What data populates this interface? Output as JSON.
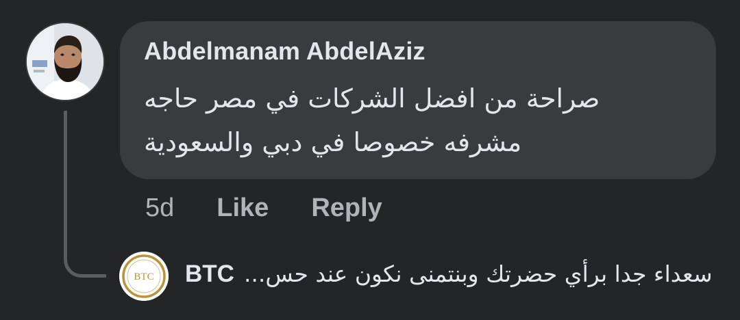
{
  "comment": {
    "author": "Abdelmanam AbdelAziz",
    "text_lines": [
      "صراحة من افضل الشركات في مصر حاجه",
      "مشرفه خصوصا في دبي والسعودية"
    ],
    "time": "5d",
    "like_label": "Like",
    "reply_label": "Reply"
  },
  "reply": {
    "author": "BTC",
    "avatar_logo_text": "BTC",
    "text": "سعداء جدا برأي حضرتك وبنتمنى نكون عند حس..."
  },
  "colors": {
    "background": "#242526",
    "bubble": "#3a3b3c",
    "primary_text": "#e4e6eb",
    "secondary_text": "#b0b3b8",
    "thread_line": "#5b5c5e",
    "btc_gold": "#b8933a"
  }
}
